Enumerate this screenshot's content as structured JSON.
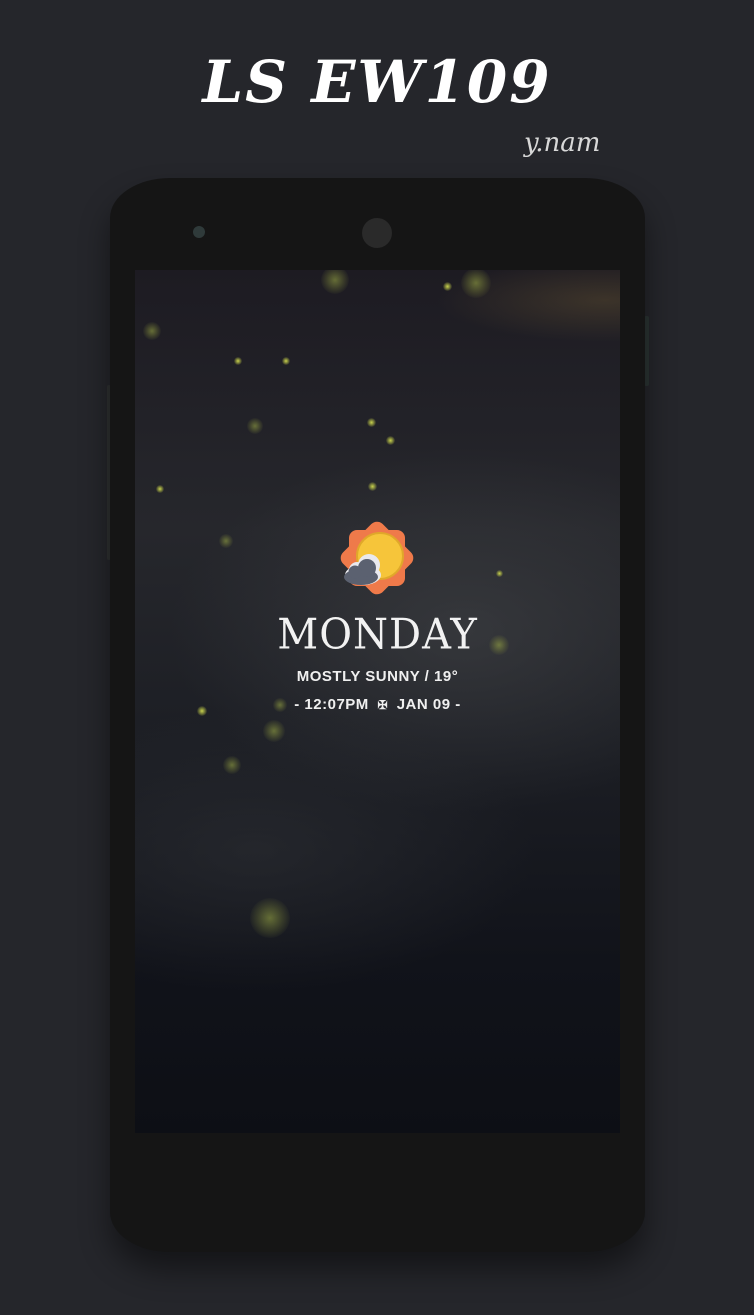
{
  "header": {
    "title": "LS EW109",
    "author": "y.nam"
  },
  "widget": {
    "weather_icon": "partly-cloudy-sun-icon",
    "day": "MONDAY",
    "condition": "MOSTLY SUNNY / 19°",
    "time_prefix": "- 12:07PM",
    "separator": "✠",
    "date_suffix": "JAN 09 -"
  },
  "colors": {
    "background": "#25262b",
    "phone_body": "#151515",
    "sun": "#f6c53a",
    "sun_badge": "#ef7a4a",
    "firefly": "#d2dc50"
  }
}
